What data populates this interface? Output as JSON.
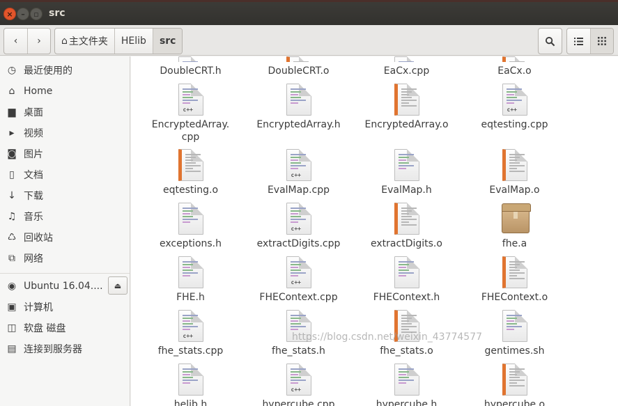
{
  "window": {
    "title": "src"
  },
  "toolbar": {
    "path": [
      {
        "label": "主文件夹",
        "icon": "home-icon"
      },
      {
        "label": "HElib"
      },
      {
        "label": "src"
      }
    ]
  },
  "sidebar": {
    "items": [
      {
        "label": "最近使用的",
        "icon": "clock-icon"
      },
      {
        "label": "Home",
        "icon": "home-icon"
      },
      {
        "label": "桌面",
        "icon": "folder-icon"
      },
      {
        "label": "视频",
        "icon": "video-icon"
      },
      {
        "label": "图片",
        "icon": "camera-icon"
      },
      {
        "label": "文档",
        "icon": "document-icon"
      },
      {
        "label": "下载",
        "icon": "download-icon"
      },
      {
        "label": "音乐",
        "icon": "music-icon"
      },
      {
        "label": "回收站",
        "icon": "trash-icon"
      },
      {
        "label": "网络",
        "icon": "network-icon"
      }
    ],
    "devices": [
      {
        "label": "Ubuntu 16.04....",
        "icon": "disc-icon"
      },
      {
        "label": "计算机",
        "icon": "computer-icon"
      },
      {
        "label": "软盘 磁盘",
        "icon": "floppy-icon"
      },
      {
        "label": "连接到服务器",
        "icon": "server-icon"
      }
    ]
  },
  "files": [
    {
      "name": "DoubleCRT.h",
      "kind": "h"
    },
    {
      "name": "DoubleCRT.o",
      "kind": "o"
    },
    {
      "name": "EaCx.cpp",
      "kind": "cpp"
    },
    {
      "name": "EaCx.o",
      "kind": "o"
    },
    {
      "name": "EncryptedArray.\ncpp",
      "kind": "cpp"
    },
    {
      "name": "EncryptedArray.h",
      "kind": "h"
    },
    {
      "name": "EncryptedArray.o",
      "kind": "o"
    },
    {
      "name": "eqtesting.cpp",
      "kind": "cpp"
    },
    {
      "name": "eqtesting.o",
      "kind": "o"
    },
    {
      "name": "EvalMap.cpp",
      "kind": "cpp"
    },
    {
      "name": "EvalMap.h",
      "kind": "h"
    },
    {
      "name": "EvalMap.o",
      "kind": "o"
    },
    {
      "name": "exceptions.h",
      "kind": "h"
    },
    {
      "name": "extractDigits.cpp",
      "kind": "cpp"
    },
    {
      "name": "extractDigits.o",
      "kind": "o"
    },
    {
      "name": "fhe.a",
      "kind": "a"
    },
    {
      "name": "FHE.h",
      "kind": "h"
    },
    {
      "name": "FHEContext.cpp",
      "kind": "cpp"
    },
    {
      "name": "FHEContext.h",
      "kind": "h"
    },
    {
      "name": "FHEContext.o",
      "kind": "o"
    },
    {
      "name": "fhe_stats.cpp",
      "kind": "cpp"
    },
    {
      "name": "fhe_stats.h",
      "kind": "h"
    },
    {
      "name": "fhe_stats.o",
      "kind": "o"
    },
    {
      "name": "gentimes.sh",
      "kind": "sh"
    },
    {
      "name": "helib.h",
      "kind": "h"
    },
    {
      "name": "hypercube.cpp",
      "kind": "cpp"
    },
    {
      "name": "hypercube.h",
      "kind": "h"
    },
    {
      "name": "hypercube.o",
      "kind": "o"
    }
  ],
  "watermark": "https://blog.csdn.net/weixin_43774577"
}
